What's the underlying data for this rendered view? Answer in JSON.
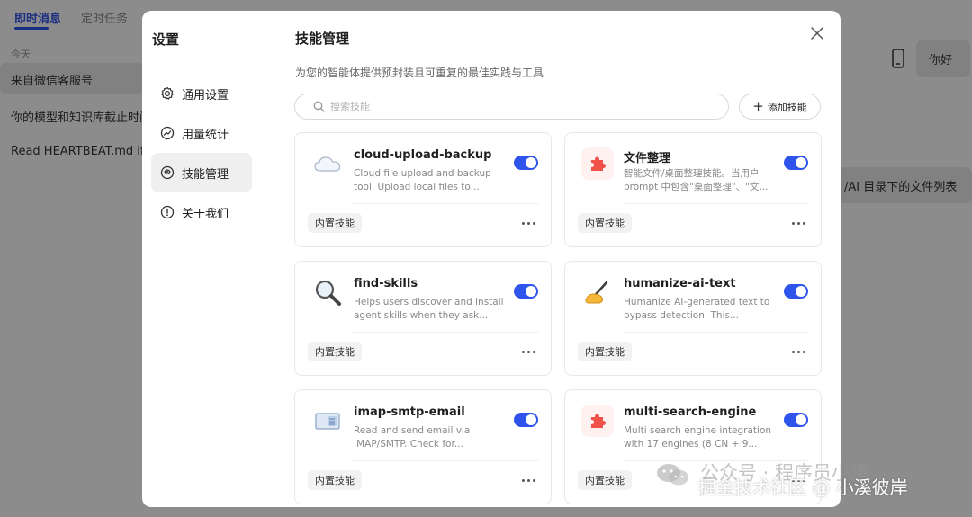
{
  "background_app": {
    "tabs": [
      {
        "label": "即时消息",
        "active": true
      },
      {
        "label": "定时任务",
        "active": false
      }
    ],
    "date_group": "今天",
    "conversations": [
      {
        "title": "来自微信客服号",
        "selected": true
      },
      {
        "title": "你的模型和知识库截止时间",
        "selected": false
      },
      {
        "title": "Read HEARTBEAT.md if it exists",
        "selected": false
      }
    ],
    "chat_bubbles": {
      "hello": "你好",
      "file_list": "/AI 目录下的文件列表"
    }
  },
  "modal": {
    "title": "设置",
    "nav": [
      {
        "label": "通用设置",
        "icon": "gear-icon",
        "active": false
      },
      {
        "label": "用量统计",
        "icon": "usage-chart-icon",
        "active": false
      },
      {
        "label": "技能管理",
        "icon": "skill-icon",
        "active": true
      },
      {
        "label": "关于我们",
        "icon": "info-icon",
        "active": false
      }
    ],
    "close_icon": "close-icon"
  },
  "skills_page": {
    "title": "技能管理",
    "subtitle": "为您的智能体提供预封装且可重复的最佳实践与工具",
    "search": {
      "placeholder": "搜索技能",
      "value": ""
    },
    "add_button_label": "添加技能",
    "accent_color": "#2f54eb",
    "skills": [
      {
        "name": "cloud-upload-backup",
        "description": "Cloud file upload and backup tool. Upload local files to...",
        "icon": "cloud-icon",
        "enabled": true,
        "badge": "内置技能"
      },
      {
        "name": "文件整理",
        "description": "智能文件/桌面整理技能。当用户 prompt 中包含\"桌面整理\"、\"文...",
        "icon": "puzzle-icon",
        "enabled": true,
        "badge": "内置技能"
      },
      {
        "name": "find-skills",
        "description": "Helps users discover and install agent skills when they ask...",
        "icon": "magnifier-icon",
        "enabled": true,
        "badge": "内置技能"
      },
      {
        "name": "humanize-ai-text",
        "description": "Humanize AI-generated text to bypass detection. This...",
        "icon": "writing-hand-icon",
        "enabled": true,
        "badge": "内置技能"
      },
      {
        "name": "imap-smtp-email",
        "description": "Read and send email via IMAP/SMTP. Check for...",
        "icon": "email-icon",
        "enabled": true,
        "badge": "内置技能"
      },
      {
        "name": "multi-search-engine",
        "description": "Multi search engine integration with 17 engines (8 CN + 9...",
        "icon": "puzzle-icon",
        "enabled": true,
        "badge": "内置技能"
      }
    ]
  },
  "watermark": {
    "line1": "公众号 · 程序员小溪",
    "line2": "掘金技术社区 @ 小溪彼岸"
  }
}
